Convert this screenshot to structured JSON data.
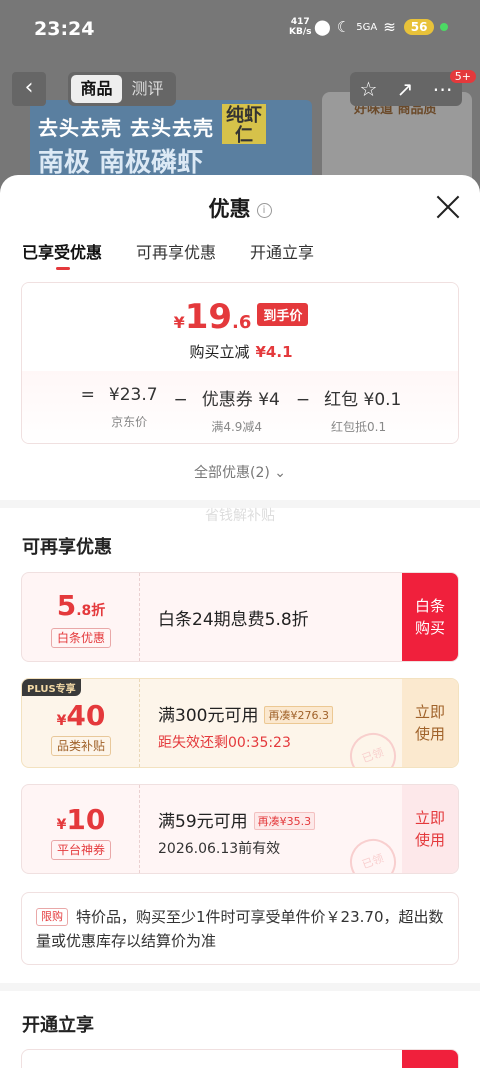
{
  "status": {
    "time": "23:24",
    "net_speed_top": "417",
    "net_speed_bottom": "KB/s",
    "signal": "5GA",
    "battery": "56"
  },
  "nav": {
    "back": "‹",
    "tabs": [
      {
        "label": "商品"
      },
      {
        "label": "测评"
      }
    ],
    "cart_count": "5+"
  },
  "product": {
    "title1": "去头去壳 去头去壳",
    "title2": "南极 南极磷虾",
    "tag": "纯虾仁",
    "side_title": "好味道 商品质"
  },
  "sheet": {
    "title": "优惠",
    "info": "i",
    "tabs": [
      {
        "label": "已享受优惠"
      },
      {
        "label": "可再享优惠"
      },
      {
        "label": "开通立享"
      }
    ],
    "price": {
      "yen": "¥",
      "integer": "19",
      "decimal": ".6",
      "tag": "到手价",
      "reduce_label": "购买立减",
      "reduce_value": "¥4.1"
    },
    "formula": [
      {
        "op": "=",
        "value": "¥23.7",
        "label": "京东价"
      },
      {
        "op": "−",
        "value": "优惠券 ¥4",
        "label": "满4.9减4"
      },
      {
        "op": "−",
        "value": "红包 ¥0.1",
        "label": "红包抵0.1"
      }
    ],
    "all_preferential": "全部优惠(2)",
    "faint_text": "省钱解补贴",
    "section_more": "可再享优惠",
    "cards": [
      {
        "amount_prefix": "",
        "amount": "5",
        "amount_suffix": ".8折",
        "label": "白条优惠",
        "cond": "白条24期息费5.8折",
        "extra": "",
        "sub": "",
        "btn": "白条购买"
      },
      {
        "plus": "PLUS专享",
        "amount_prefix": "¥",
        "amount": "40",
        "amount_suffix": "",
        "label": "品类补贴",
        "cond": "满300元可用",
        "extra": "再凑¥276.3",
        "sub": "距失效还剩00:35:23",
        "btn": "立即使用",
        "stamp": "已领"
      },
      {
        "amount_prefix": "¥",
        "amount": "10",
        "amount_suffix": "",
        "label": "平台神券",
        "cond": "满59元可用",
        "extra": "再凑¥35.3",
        "sub": "2026.06.13前有效",
        "btn": "立即使用",
        "stamp": "已领"
      }
    ],
    "limit": {
      "tag": "限购",
      "text": "特价品，购买至少1件时可享受单件价￥23.70，超出数量或优惠库存以结算价为准"
    },
    "section_open": "开通立享"
  },
  "colors": {
    "accent": "#e4393c",
    "gold": "#f3e2c0",
    "pink": "#fdf0f0"
  }
}
